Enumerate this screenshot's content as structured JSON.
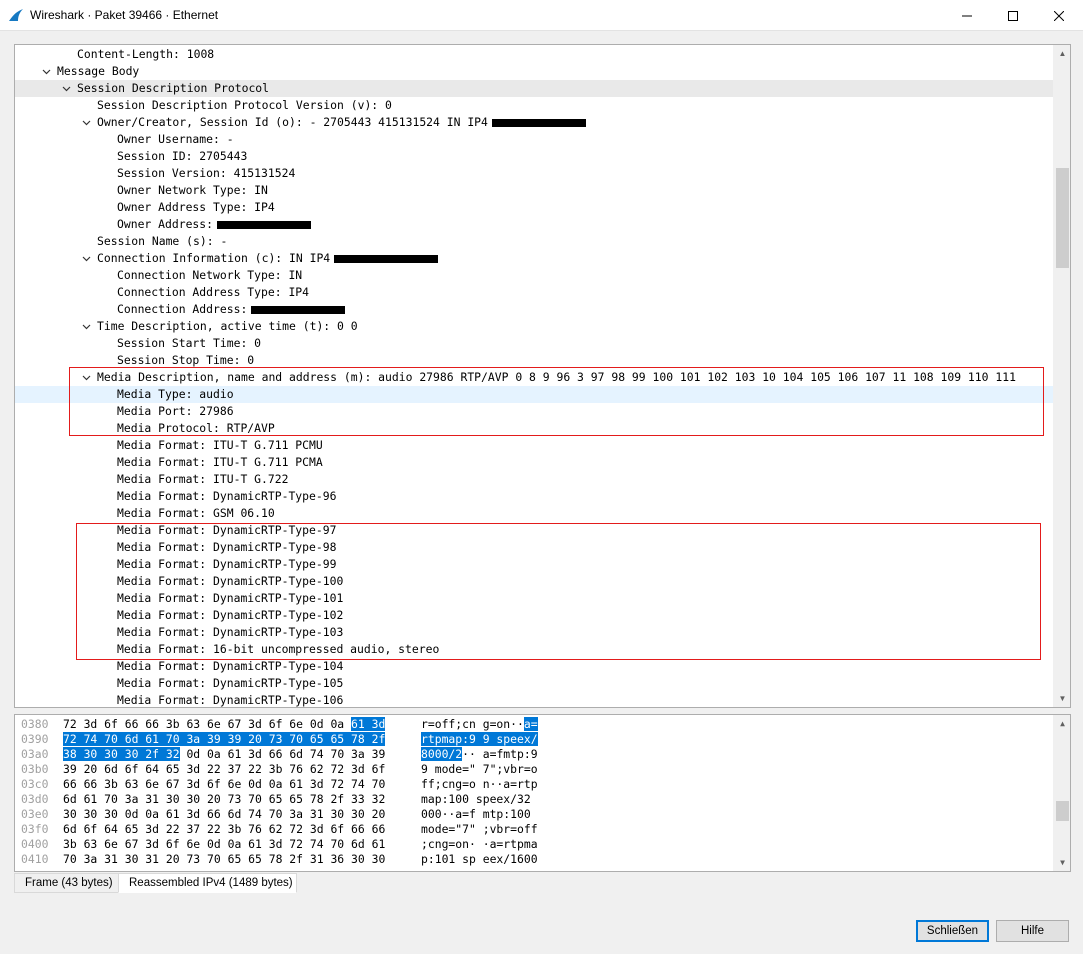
{
  "window": {
    "title": "Wireshark · Paket 39466 · Ethernet",
    "min_label": "–",
    "max_label": "☐",
    "close_label": "✕"
  },
  "tree": {
    "rows": [
      {
        "text": "Content-Length: 1008",
        "level": 2,
        "expander": ""
      },
      {
        "text": "Message Body",
        "level": 1,
        "expander": "open"
      },
      {
        "text": "Session Description Protocol",
        "level": 2,
        "expander": "open",
        "highlight": "grey"
      },
      {
        "text": "Session Description Protocol Version (v): 0",
        "level": 3,
        "expander": ""
      },
      {
        "text": "Owner/Creator, Session Id (o): - 2705443 415131524 IN IP4",
        "level": 3,
        "expander": "open",
        "redacted": true
      },
      {
        "text": "Owner Username: -",
        "level": 4,
        "expander": ""
      },
      {
        "text": "Session ID: 2705443",
        "level": 4,
        "expander": ""
      },
      {
        "text": "Session Version: 415131524",
        "level": 4,
        "expander": ""
      },
      {
        "text": "Owner Network Type: IN",
        "level": 4,
        "expander": ""
      },
      {
        "text": "Owner Address Type: IP4",
        "level": 4,
        "expander": ""
      },
      {
        "text": "Owner Address:",
        "level": 4,
        "expander": "",
        "redacted": true
      },
      {
        "text": "Session Name (s): -",
        "level": 3,
        "expander": ""
      },
      {
        "text": "Connection Information (c): IN IP4",
        "level": 3,
        "expander": "open",
        "redacted": true
      },
      {
        "text": "Connection Network Type: IN",
        "level": 4,
        "expander": ""
      },
      {
        "text": "Connection Address Type: IP4",
        "level": 4,
        "expander": ""
      },
      {
        "text": "Connection Address:",
        "level": 4,
        "expander": "",
        "redacted": true
      },
      {
        "text": "Time Description, active time (t): 0 0",
        "level": 3,
        "expander": "open"
      },
      {
        "text": "Session Start Time: 0",
        "level": 4,
        "expander": ""
      },
      {
        "text": "Session Stop Time: 0",
        "level": 4,
        "expander": ""
      },
      {
        "text": "Media Description, name and address (m): audio 27986 RTP/AVP 0 8 9 96 3 97 98 99 100 101 102 103 10 104 105 106 107 11 108 109 110 111",
        "level": 3,
        "expander": "open"
      },
      {
        "text": "Media Type: audio",
        "level": 4,
        "expander": "",
        "highlight": "blue"
      },
      {
        "text": "Media Port: 27986",
        "level": 4,
        "expander": ""
      },
      {
        "text": "Media Protocol: RTP/AVP",
        "level": 4,
        "expander": ""
      },
      {
        "text": "Media Format: ITU-T G.711 PCMU",
        "level": 4,
        "expander": ""
      },
      {
        "text": "Media Format: ITU-T G.711 PCMA",
        "level": 4,
        "expander": ""
      },
      {
        "text": "Media Format: ITU-T G.722",
        "level": 4,
        "expander": ""
      },
      {
        "text": "Media Format: DynamicRTP-Type-96",
        "level": 4,
        "expander": ""
      },
      {
        "text": "Media Format: GSM 06.10",
        "level": 4,
        "expander": ""
      },
      {
        "text": "Media Format: DynamicRTP-Type-97",
        "level": 4,
        "expander": ""
      },
      {
        "text": "Media Format: DynamicRTP-Type-98",
        "level": 4,
        "expander": ""
      },
      {
        "text": "Media Format: DynamicRTP-Type-99",
        "level": 4,
        "expander": ""
      },
      {
        "text": "Media Format: DynamicRTP-Type-100",
        "level": 4,
        "expander": ""
      },
      {
        "text": "Media Format: DynamicRTP-Type-101",
        "level": 4,
        "expander": ""
      },
      {
        "text": "Media Format: DynamicRTP-Type-102",
        "level": 4,
        "expander": ""
      },
      {
        "text": "Media Format: DynamicRTP-Type-103",
        "level": 4,
        "expander": ""
      },
      {
        "text": "Media Format: 16-bit uncompressed audio, stereo",
        "level": 4,
        "expander": ""
      },
      {
        "text": "Media Format: DynamicRTP-Type-104",
        "level": 4,
        "expander": ""
      },
      {
        "text": "Media Format: DynamicRTP-Type-105",
        "level": 4,
        "expander": ""
      },
      {
        "text": "Media Format: DynamicRTP-Type-106",
        "level": 4,
        "expander": ""
      }
    ]
  },
  "hex": {
    "rows": [
      {
        "offset": "0380",
        "pre": "72 3d 6f 66 66 3b 63 6e  67 3d 6f 6e 0d 0a ",
        "hl": "61 3d",
        "post": "",
        "a_pre": "r=off;cn g=on··",
        "a_hl": "a=",
        "a_post": ""
      },
      {
        "offset": "0390",
        "pre": "",
        "hl": "72 74 70 6d 61 70 3a 39  39 20 73 70 65 65 78 2f",
        "post": "",
        "a_pre": "",
        "a_hl": "rtpmap:9 9 speex/",
        "a_post": ""
      },
      {
        "offset": "03a0",
        "pre": "",
        "hl": "38 30 30 30 2f 32",
        "post": " 0d 0a  61 3d 66 6d 74 70 3a 39",
        "a_pre": "",
        "a_hl": "8000/2",
        "a_post": "·· a=fmtp:9"
      },
      {
        "offset": "03b0",
        "pre": "39 20 6d 6f 64 65 3d 22  37 22 3b 76 62 72 3d 6f",
        "hl": "",
        "post": "",
        "a_pre": "9 mode=\" 7\";vbr=o",
        "a_hl": "",
        "a_post": ""
      },
      {
        "offset": "03c0",
        "pre": "66 66 3b 63 6e 67 3d 6f  6e 0d 0a 61 3d 72 74 70",
        "hl": "",
        "post": "",
        "a_pre": "ff;cng=o n··a=rtp",
        "a_hl": "",
        "a_post": ""
      },
      {
        "offset": "03d0",
        "pre": "6d 61 70 3a 31 30 30 20  73 70 65 65 78 2f 33 32",
        "hl": "",
        "post": "",
        "a_pre": "map:100  speex/32",
        "a_hl": "",
        "a_post": ""
      },
      {
        "offset": "03e0",
        "pre": "30 30 30 0d 0a 61 3d 66  6d 74 70 3a 31 30 30 20",
        "hl": "",
        "post": "",
        "a_pre": "000··a=f mtp:100 ",
        "a_hl": "",
        "a_post": ""
      },
      {
        "offset": "03f0",
        "pre": "6d 6f 64 65 3d 22 37 22  3b 76 62 72 3d 6f 66 66",
        "hl": "",
        "post": "",
        "a_pre": "mode=\"7\" ;vbr=off",
        "a_hl": "",
        "a_post": ""
      },
      {
        "offset": "0400",
        "pre": "3b 63 6e 67 3d 6f 6e 0d  0a 61 3d 72 74 70 6d 61",
        "hl": "",
        "post": "",
        "a_pre": ";cng=on· ·a=rtpma",
        "a_hl": "",
        "a_post": ""
      },
      {
        "offset": "0410",
        "pre": "70 3a 31 30 31 20 73 70  65 65 78 2f 31 36 30 30",
        "hl": "",
        "post": "",
        "a_pre": "p:101 sp eex/1600",
        "a_hl": "",
        "a_post": ""
      }
    ]
  },
  "tabs": {
    "frame": "Frame (43 bytes)",
    "reassembled": "Reassembled IPv4 (1489 bytes)"
  },
  "buttons": {
    "close": "Schließen",
    "help": "Hilfe"
  },
  "colors": {
    "selection": "#0078d7",
    "annotation_box": "#e31b1b"
  }
}
